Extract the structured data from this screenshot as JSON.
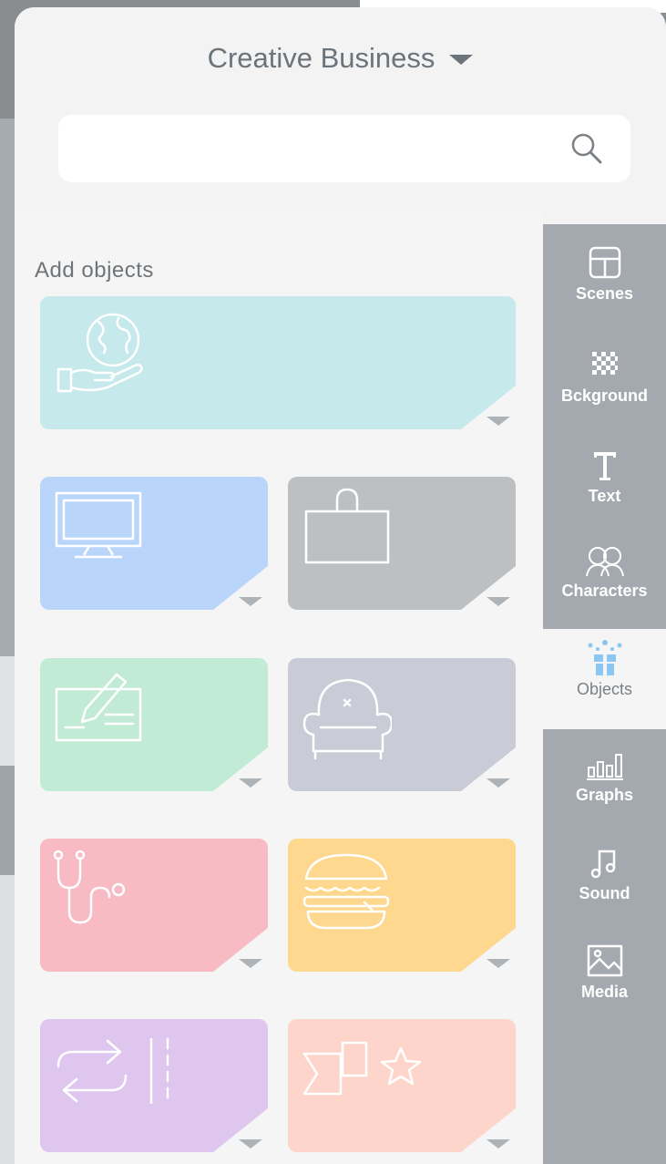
{
  "header": {
    "title": "Creative Business",
    "search_placeholder": ""
  },
  "main": {
    "add_objects_label": "Add objects",
    "tiles": [
      {
        "category": "globe-in-hand",
        "color": "#c6e9ec"
      },
      {
        "category": "television",
        "color": "#b9d5fa"
      },
      {
        "category": "shopping-bag",
        "color": "#bdc0c3"
      },
      {
        "category": "check-signing",
        "color": "#c2ebd6"
      },
      {
        "category": "armchair",
        "color": "#c9ccd6"
      },
      {
        "category": "stethoscope",
        "color": "#f8bac3"
      },
      {
        "category": "burger",
        "color": "#fed88e"
      },
      {
        "category": "arrows-exchange",
        "color": "#dfc6ee"
      },
      {
        "category": "flag-star",
        "color": "#fdd5ca"
      }
    ]
  },
  "sidebar": {
    "items": [
      {
        "label": "Scenes",
        "icon": "scenes-icon"
      },
      {
        "label": "Bckground",
        "icon": "background-icon"
      },
      {
        "label": "Text",
        "icon": "text-icon"
      },
      {
        "label": "Characters",
        "icon": "characters-icon"
      },
      {
        "label": "Objects",
        "icon": "objects-icon",
        "active": true
      },
      {
        "label": "Graphs",
        "icon": "graphs-icon"
      },
      {
        "label": "Sound",
        "icon": "sound-icon"
      },
      {
        "label": "Media",
        "icon": "media-icon"
      }
    ]
  },
  "colors": {
    "sidebar_bg": "#a3a9ae",
    "active_accent": "#8cc6f2",
    "title_text": "#6b737b"
  }
}
